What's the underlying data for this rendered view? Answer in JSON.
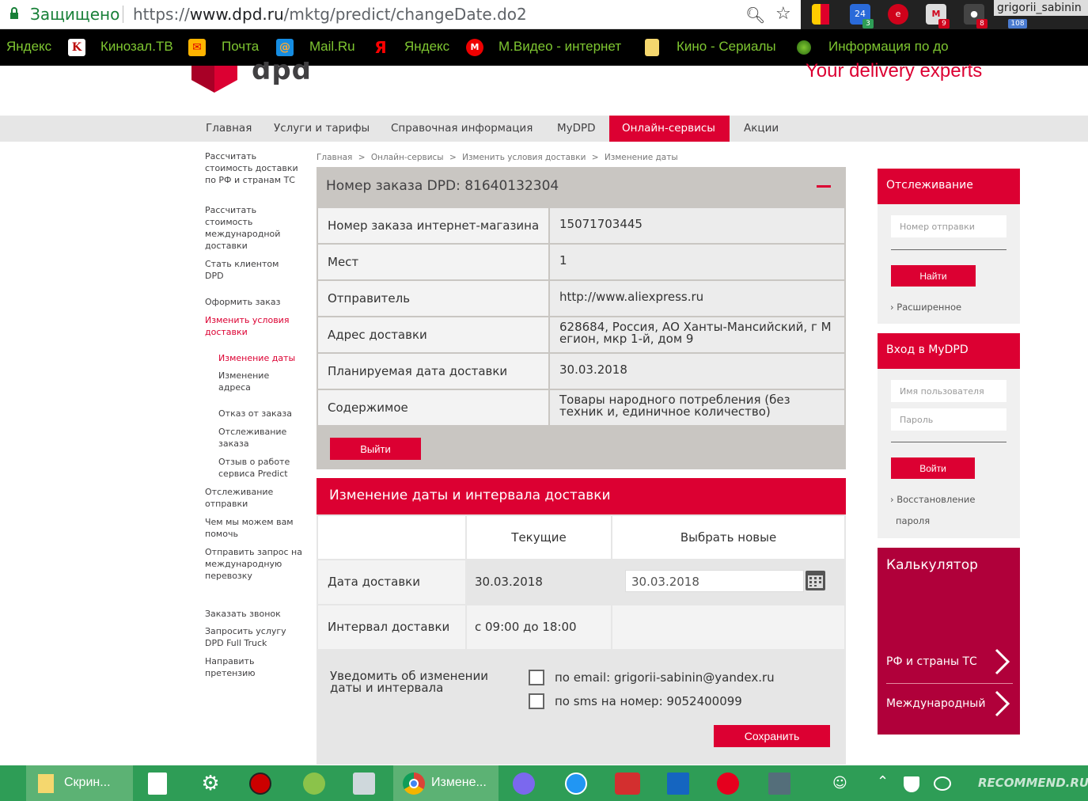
{
  "browser": {
    "secure_label": "Защищено",
    "url_prefix": "https://",
    "url_host": "www.dpd.ru",
    "url_path": "/mktg/predict/changeDate.do2",
    "profile_name": "grigorii_sabinin",
    "extensions": [
      {
        "name": "bookmark-flag-icon",
        "badge": ""
      },
      {
        "name": "calendar-24-icon",
        "label": "24",
        "badge": "3"
      },
      {
        "name": "red-circle-icon",
        "badge": ""
      },
      {
        "name": "mail-icon",
        "badge": "9"
      },
      {
        "name": "shield-icon",
        "badge": "8"
      },
      {
        "name": "extension-108-icon",
        "badge": "108"
      }
    ]
  },
  "bookmarks": [
    {
      "label": "Яндекс",
      "icon": "yandex-icon"
    },
    {
      "label": "Кинозал.ТВ",
      "icon": "kinozal-icon"
    },
    {
      "label": "Почта",
      "icon": "gmail-icon"
    },
    {
      "label": "Mail.Ru",
      "icon": "mailru-icon"
    },
    {
      "label": "Яндекс",
      "icon": "yandex-y-icon"
    },
    {
      "label": "М.Видео - интернет",
      "icon": "mvideo-icon"
    },
    {
      "label": "Кино - Сериалы",
      "icon": "folder-icon"
    },
    {
      "label": "Информация по до",
      "icon": "globe-icon"
    }
  ],
  "site": {
    "logo_text": "dpd",
    "tagline": "Your delivery experts"
  },
  "nav": [
    {
      "label": "Главная",
      "active": false
    },
    {
      "label": "Услуги и тарифы",
      "active": false
    },
    {
      "label": "Справочная информация",
      "active": false
    },
    {
      "label": "MyDPD",
      "active": false
    },
    {
      "label": "Онлайн-сервисы",
      "active": true
    },
    {
      "label": "Акции",
      "active": false
    }
  ],
  "leftnav": [
    "Рассчитать стоимость доставки по РФ и странам ТС",
    "Рассчитать стоимость международной доставки",
    "Стать клиентом DPD",
    "Оформить заказ",
    "Изменить условия доставки",
    "Изменение даты",
    "Изменение адреса",
    "Отказ от заказа",
    "Отслеживание заказа",
    "Отзыв о работе сервиса Predict",
    "Отслеживание отправки",
    "Чем мы можем вам помочь",
    "Отправить запрос на международную перевозку",
    "Заказать звонок",
    "Запросить услугу DPD Full Truck",
    "Направить претензию"
  ],
  "breadcrumb": [
    "Главная",
    "Онлайн-сервисы",
    "Изменить условия доставки",
    "Изменение даты"
  ],
  "breadcrumb_sep": ">",
  "order": {
    "title": "Номер заказа DPD: 81640132304",
    "rows": [
      {
        "key": "Номер заказа интернет-магазина",
        "value": "15071703445"
      },
      {
        "key": "Мест",
        "value": "1"
      },
      {
        "key": "Отправитель",
        "value": "http://www.aliexpress.ru"
      },
      {
        "key": "Адрес доставки",
        "value": "628684, Россия, АО Ханты-Мансийский, г М егион, мкр 1-й, дом 9"
      },
      {
        "key": "Планируемая дата доставки",
        "value": "30.03.2018"
      },
      {
        "key": "Содержимое",
        "value": "Товары народного потребления (без техник и, единичное количество)"
      }
    ],
    "logout_label": "Выйти"
  },
  "change": {
    "title": "Изменение даты и интервала доставки",
    "col_current": "Текущие",
    "col_new": "Выбрать новые",
    "date_label": "Дата доставки",
    "date_current": "30.03.2018",
    "date_new": "30.03.2018",
    "interval_label": "Интервал доставки",
    "interval_current": "с 09:00 до 18:00",
    "notify_label": "Уведомить об изменении даты и интервала",
    "notify_email": "по email: grigorii-sabinin@yandex.ru",
    "notify_sms": "по sms на номер: 9052400099",
    "save_label": "Сохранить"
  },
  "tracking": {
    "title": "Отслеживание",
    "placeholder": "Номер отправки",
    "find_label": "Найти",
    "advanced": "› Расширенное"
  },
  "login": {
    "title": "Вход в MyDPD",
    "user_placeholder": "Имя пользователя",
    "pass_placeholder": "Пароль",
    "login_label": "Войти",
    "restore_1": "› Восстановление",
    "restore_2": "пароля"
  },
  "calculator": {
    "title": "Калькулятор",
    "item1": "РФ и страны ТС",
    "item2": "Международный"
  },
  "taskbar": {
    "screenshot_label": "Скрин...",
    "chrome_label": "Измене...",
    "watermark": "RECOMMEND.RU"
  },
  "colors": {
    "accent": "#dc0032",
    "taskbar": "#2e9d56",
    "bookmark_text": "#7ec631"
  }
}
